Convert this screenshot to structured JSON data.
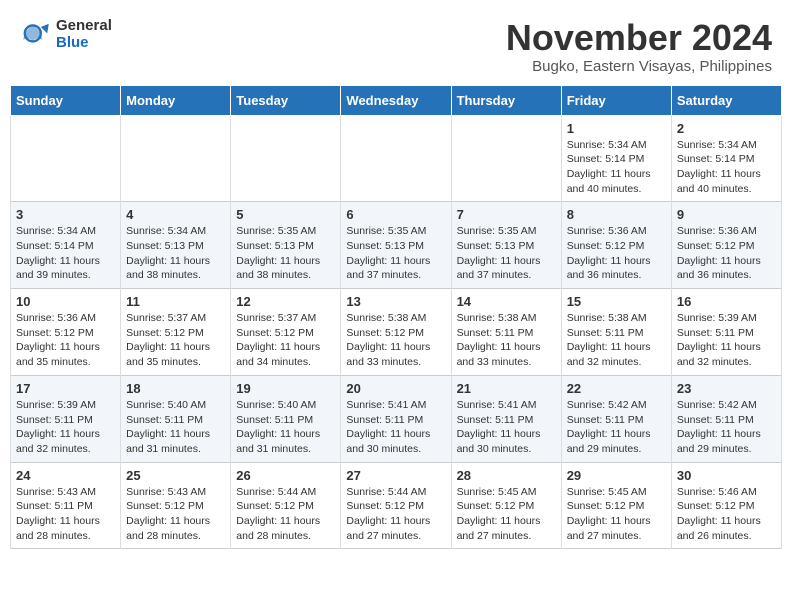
{
  "header": {
    "logo_general": "General",
    "logo_blue": "Blue",
    "month_title": "November 2024",
    "location": "Bugko, Eastern Visayas, Philippines"
  },
  "columns": [
    "Sunday",
    "Monday",
    "Tuesday",
    "Wednesday",
    "Thursday",
    "Friday",
    "Saturday"
  ],
  "weeks": [
    [
      {
        "day": "",
        "info": ""
      },
      {
        "day": "",
        "info": ""
      },
      {
        "day": "",
        "info": ""
      },
      {
        "day": "",
        "info": ""
      },
      {
        "day": "",
        "info": ""
      },
      {
        "day": "1",
        "info": "Sunrise: 5:34 AM\nSunset: 5:14 PM\nDaylight: 11 hours\nand 40 minutes."
      },
      {
        "day": "2",
        "info": "Sunrise: 5:34 AM\nSunset: 5:14 PM\nDaylight: 11 hours\nand 40 minutes."
      }
    ],
    [
      {
        "day": "3",
        "info": "Sunrise: 5:34 AM\nSunset: 5:14 PM\nDaylight: 11 hours\nand 39 minutes."
      },
      {
        "day": "4",
        "info": "Sunrise: 5:34 AM\nSunset: 5:13 PM\nDaylight: 11 hours\nand 38 minutes."
      },
      {
        "day": "5",
        "info": "Sunrise: 5:35 AM\nSunset: 5:13 PM\nDaylight: 11 hours\nand 38 minutes."
      },
      {
        "day": "6",
        "info": "Sunrise: 5:35 AM\nSunset: 5:13 PM\nDaylight: 11 hours\nand 37 minutes."
      },
      {
        "day": "7",
        "info": "Sunrise: 5:35 AM\nSunset: 5:13 PM\nDaylight: 11 hours\nand 37 minutes."
      },
      {
        "day": "8",
        "info": "Sunrise: 5:36 AM\nSunset: 5:12 PM\nDaylight: 11 hours\nand 36 minutes."
      },
      {
        "day": "9",
        "info": "Sunrise: 5:36 AM\nSunset: 5:12 PM\nDaylight: 11 hours\nand 36 minutes."
      }
    ],
    [
      {
        "day": "10",
        "info": "Sunrise: 5:36 AM\nSunset: 5:12 PM\nDaylight: 11 hours\nand 35 minutes."
      },
      {
        "day": "11",
        "info": "Sunrise: 5:37 AM\nSunset: 5:12 PM\nDaylight: 11 hours\nand 35 minutes."
      },
      {
        "day": "12",
        "info": "Sunrise: 5:37 AM\nSunset: 5:12 PM\nDaylight: 11 hours\nand 34 minutes."
      },
      {
        "day": "13",
        "info": "Sunrise: 5:38 AM\nSunset: 5:12 PM\nDaylight: 11 hours\nand 33 minutes."
      },
      {
        "day": "14",
        "info": "Sunrise: 5:38 AM\nSunset: 5:11 PM\nDaylight: 11 hours\nand 33 minutes."
      },
      {
        "day": "15",
        "info": "Sunrise: 5:38 AM\nSunset: 5:11 PM\nDaylight: 11 hours\nand 32 minutes."
      },
      {
        "day": "16",
        "info": "Sunrise: 5:39 AM\nSunset: 5:11 PM\nDaylight: 11 hours\nand 32 minutes."
      }
    ],
    [
      {
        "day": "17",
        "info": "Sunrise: 5:39 AM\nSunset: 5:11 PM\nDaylight: 11 hours\nand 32 minutes."
      },
      {
        "day": "18",
        "info": "Sunrise: 5:40 AM\nSunset: 5:11 PM\nDaylight: 11 hours\nand 31 minutes."
      },
      {
        "day": "19",
        "info": "Sunrise: 5:40 AM\nSunset: 5:11 PM\nDaylight: 11 hours\nand 31 minutes."
      },
      {
        "day": "20",
        "info": "Sunrise: 5:41 AM\nSunset: 5:11 PM\nDaylight: 11 hours\nand 30 minutes."
      },
      {
        "day": "21",
        "info": "Sunrise: 5:41 AM\nSunset: 5:11 PM\nDaylight: 11 hours\nand 30 minutes."
      },
      {
        "day": "22",
        "info": "Sunrise: 5:42 AM\nSunset: 5:11 PM\nDaylight: 11 hours\nand 29 minutes."
      },
      {
        "day": "23",
        "info": "Sunrise: 5:42 AM\nSunset: 5:11 PM\nDaylight: 11 hours\nand 29 minutes."
      }
    ],
    [
      {
        "day": "24",
        "info": "Sunrise: 5:43 AM\nSunset: 5:11 PM\nDaylight: 11 hours\nand 28 minutes."
      },
      {
        "day": "25",
        "info": "Sunrise: 5:43 AM\nSunset: 5:12 PM\nDaylight: 11 hours\nand 28 minutes."
      },
      {
        "day": "26",
        "info": "Sunrise: 5:44 AM\nSunset: 5:12 PM\nDaylight: 11 hours\nand 28 minutes."
      },
      {
        "day": "27",
        "info": "Sunrise: 5:44 AM\nSunset: 5:12 PM\nDaylight: 11 hours\nand 27 minutes."
      },
      {
        "day": "28",
        "info": "Sunrise: 5:45 AM\nSunset: 5:12 PM\nDaylight: 11 hours\nand 27 minutes."
      },
      {
        "day": "29",
        "info": "Sunrise: 5:45 AM\nSunset: 5:12 PM\nDaylight: 11 hours\nand 27 minutes."
      },
      {
        "day": "30",
        "info": "Sunrise: 5:46 AM\nSunset: 5:12 PM\nDaylight: 11 hours\nand 26 minutes."
      }
    ]
  ]
}
